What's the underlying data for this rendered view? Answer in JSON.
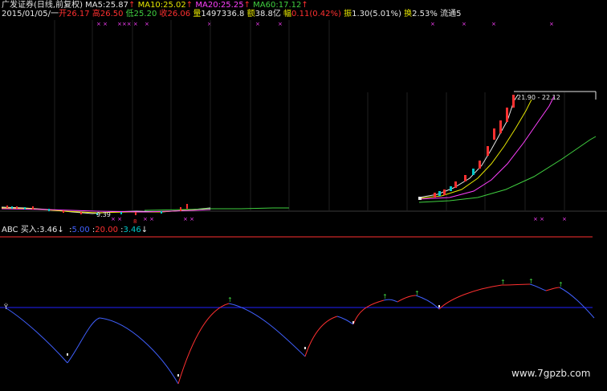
{
  "header": {
    "name": "广发证券(日线,前复权)",
    "ma5_label": "MA5:",
    "ma5": "25.87",
    "ma10_label": "MA10:",
    "ma10": "25.02",
    "ma20_label": "MA20:",
    "ma20": "25.25",
    "ma60_label": "MA60:",
    "ma60": "17.12",
    "up_arrow": "↑"
  },
  "quote": {
    "date": "2015/01/05/一",
    "open_label": "开",
    "open": "26.17",
    "high_label": "高",
    "high": "26.50",
    "low_label": "低",
    "low": "25.20",
    "close_label": "收",
    "close": "26.06",
    "vol_label": "量",
    "vol": "1497336.8",
    "amt_label": "额",
    "amt": "38.8亿",
    "chg_label": "幅",
    "chg": "0.11(0.42%)",
    "amp_label": "振",
    "amp": "1.30(5.01%)",
    "turn_label": "换",
    "turn": "2.53%",
    "float_label": "流通5"
  },
  "price_chart": {
    "range_label": "21.90 - 22.12",
    "low_label": "9.39"
  },
  "indicator": {
    "name": "ABC",
    "buy_label": "买入:",
    "buy_value": "3.46",
    "p1": "5.00",
    "p2": "20.00",
    "p3": "3.46",
    "down_arrow": "↓"
  },
  "colors": {
    "background": "#000000",
    "ma5": "#e6e6e6",
    "ma10": "#e6e600",
    "ma20": "#ff40ff",
    "ma60": "#40d040",
    "up": "#ff3030",
    "down": "#4060ff",
    "baseline": "#2020ff"
  },
  "watermark": "www.7gpzb.com"
}
